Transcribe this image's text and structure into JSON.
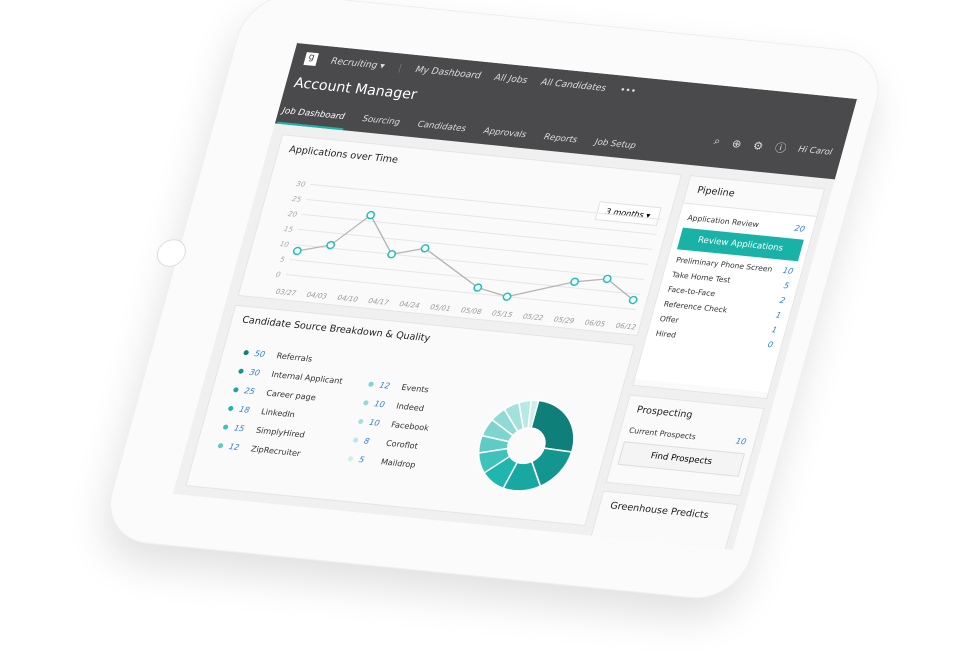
{
  "header": {
    "logo": "g",
    "app": "Recruiting",
    "nav": [
      "My Dashboard",
      "All Jobs",
      "All Candidates",
      "•••"
    ],
    "title": "Account Manager",
    "tabs": [
      "Job Dashboard",
      "Sourcing",
      "Candidates",
      "Approvals",
      "Reports",
      "Job Setup"
    ],
    "active_tab": "Job Dashboard",
    "greeting": "Hi Carol",
    "icons": [
      "search-icon",
      "plus-circle-icon",
      "gear-icon",
      "help-icon"
    ]
  },
  "applications": {
    "title": "Applications over Time",
    "range": "3 months"
  },
  "chart_data": {
    "type": "line",
    "categories": [
      "03/27",
      "04/03",
      "04/10",
      "04/17",
      "04/24",
      "05/01",
      "05/08",
      "05/15",
      "05/22",
      "05/29",
      "06/05",
      "06/12"
    ],
    "values": [
      8,
      11,
      22,
      10,
      13,
      null,
      2,
      0,
      null,
      7,
      9,
      3
    ],
    "yticks": [
      0,
      5,
      10,
      15,
      20,
      25,
      30
    ],
    "ylim": [
      0,
      30
    ],
    "grid": true,
    "color": "#1fc0b8"
  },
  "sources": {
    "title": "Candidate Source Breakdown & Quality",
    "items": [
      {
        "count": "50",
        "name": "Referrals",
        "color": "#0e7f79"
      },
      {
        "count": "30",
        "name": "Internal Applicant",
        "color": "#13968f"
      },
      {
        "count": "25",
        "name": "Career page",
        "color": "#17a9a1"
      },
      {
        "count": "18",
        "name": "LinkedIn",
        "color": "#1fb6ae"
      },
      {
        "count": "15",
        "name": "SimplyHired",
        "color": "#3ec2ba"
      },
      {
        "count": "12",
        "name": "ZipRecruiter",
        "color": "#5fcbc4"
      },
      {
        "count": "12",
        "name": "Events",
        "color": "#7ed5cf"
      },
      {
        "count": "10",
        "name": "Indeed",
        "color": "#8fdad5"
      },
      {
        "count": "10",
        "name": "Facebook",
        "color": "#a3e1dc"
      },
      {
        "count": "8",
        "name": "Coroflot",
        "color": "#b8e8e4"
      },
      {
        "count": "5",
        "name": "Maildrop",
        "color": "#cdeeeb"
      }
    ]
  },
  "pipeline": {
    "title": "Pipeline",
    "stages": [
      {
        "name": "Application Review",
        "count": "20"
      },
      {
        "name": "Preliminary Phone Screen",
        "count": "10"
      },
      {
        "name": "Take Home Test",
        "count": "5"
      },
      {
        "name": "Face-to-Face",
        "count": "2"
      },
      {
        "name": "Reference Check",
        "count": "1"
      },
      {
        "name": "Offer",
        "count": "1"
      },
      {
        "name": "Hired",
        "count": "0"
      }
    ],
    "button": "Review Applications"
  },
  "prospecting": {
    "title": "Prospecting",
    "label": "Current Prospects",
    "count": "10",
    "button": "Find Prospects"
  },
  "predicts": {
    "title": "Greenhouse Predicts"
  }
}
